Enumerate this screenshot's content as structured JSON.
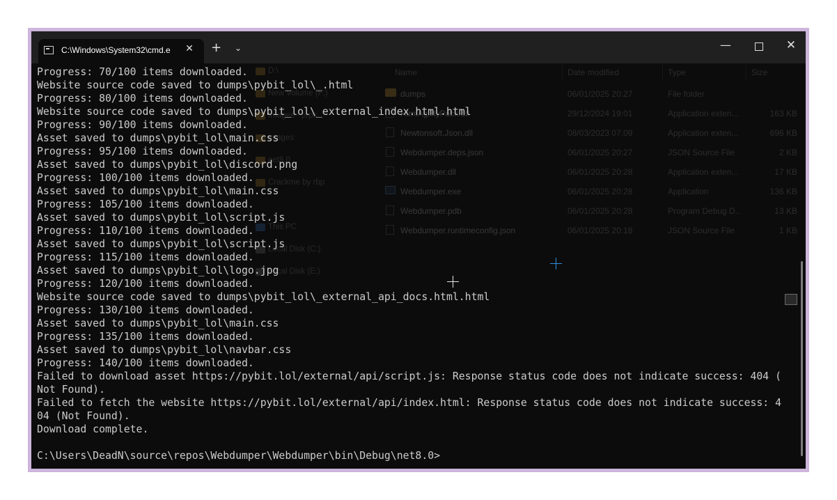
{
  "tab": {
    "title": "C:\\Windows\\System32\\cmd.e",
    "close": "✕"
  },
  "controls": {
    "new_tab": "+",
    "dropdown": "⌄",
    "minimize": "—",
    "close": "✕"
  },
  "explorer": {
    "headers": {
      "name": "Name",
      "date": "Date modified",
      "type": "Type",
      "size": "Size"
    },
    "nav": [
      {
        "label": "D:\\"
      },
      {
        "label": "New Volume (F:)"
      },
      {
        "label": "Images - prps"
      },
      {
        "label": "images"
      },
      {
        "label": "net8.0"
      },
      {
        "label": "Crackme by rbp"
      },
      {
        "label": "This PC"
      },
      {
        "label": "Local Disk (C:)"
      },
      {
        "label": "Local Disk (E:)"
      }
    ],
    "files": [
      {
        "name": "dumps",
        "date": "06/01/2025 20:27",
        "type": "File folder",
        "size": ""
      },
      {
        "name": "HtmlAgilityPack.dll",
        "date": "29/12/2024 19:01",
        "type": "Application exten...",
        "size": "163 KB"
      },
      {
        "name": "Newtonsoft.Json.dll",
        "date": "08/03/2023 07:09",
        "type": "Application exten...",
        "size": "696 KB"
      },
      {
        "name": "Webdumper.deps.json",
        "date": "06/01/2025 20:27",
        "type": "JSON Source File",
        "size": "2 KB"
      },
      {
        "name": "Webdumper.dll",
        "date": "06/01/2025 20:28",
        "type": "Application exten...",
        "size": "17 KB"
      },
      {
        "name": "Webdumper.exe",
        "date": "06/01/2025 20:28",
        "type": "Application",
        "size": "136 KB"
      },
      {
        "name": "Webdumper.pdb",
        "date": "06/01/2025 20:28",
        "type": "Program Debug D...",
        "size": "13 KB"
      },
      {
        "name": "Webdumper.runtimeconfig.json",
        "date": "06/01/2025 20:18",
        "type": "JSON Source File",
        "size": "1 KB"
      }
    ]
  },
  "console": {
    "lines": [
      "Progress: 70/100 items downloaded.",
      "Website source code saved to dumps\\pybit_lol\\_.html",
      "Progress: 80/100 items downloaded.",
      "Website source code saved to dumps\\pybit_lol\\_external_index.html.html",
      "Progress: 90/100 items downloaded.",
      "Asset saved to dumps\\pybit_lol\\main.css",
      "Progress: 95/100 items downloaded.",
      "Asset saved to dumps\\pybit_lol\\discord.png",
      "Progress: 100/100 items downloaded.",
      "Asset saved to dumps\\pybit_lol\\main.css",
      "Progress: 105/100 items downloaded.",
      "Asset saved to dumps\\pybit_lol\\script.js",
      "Progress: 110/100 items downloaded.",
      "Asset saved to dumps\\pybit_lol\\script.js",
      "Progress: 115/100 items downloaded.",
      "Asset saved to dumps\\pybit_lol\\logo.jpg",
      "Progress: 120/100 items downloaded.",
      "Website source code saved to dumps\\pybit_lol\\_external_api_docs.html.html",
      "Progress: 130/100 items downloaded.",
      "Asset saved to dumps\\pybit_lol\\main.css",
      "Progress: 135/100 items downloaded.",
      "Asset saved to dumps\\pybit_lol\\navbar.css",
      "Progress: 140/100 items downloaded.",
      "Failed to download asset https://pybit.lol/external/api/script.js: Response status code does not indicate success: 404 (",
      "Not Found).",
      "Failed to fetch the website https://pybit.lol/external/api/index.html: Response status code does not indicate success: 4",
      "04 (Not Found).",
      "Download complete.",
      "",
      "C:\\Users\\DeadN\\source\\repos\\Webdumper\\Webdumper\\bin\\Debug\\net8.0>"
    ]
  },
  "colors": {
    "console_bg": "#0c0c0c",
    "console_text": "#cccccc",
    "titlebar": "#202020",
    "border": "#cdb5dc"
  }
}
